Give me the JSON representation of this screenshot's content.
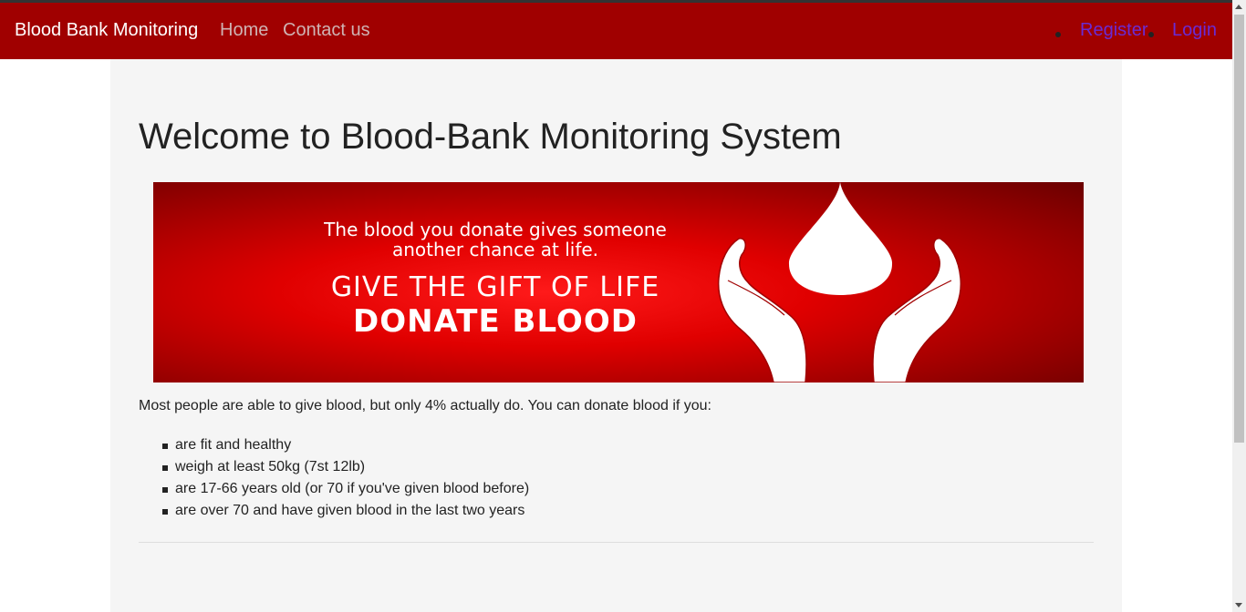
{
  "navbar": {
    "brand": "Blood Bank Monitoring",
    "links": [
      "Home",
      "Contact us"
    ],
    "right_links": [
      "Register",
      "Login"
    ],
    "background": "#a00000"
  },
  "main": {
    "title": "Welcome to Blood-Bank Monitoring System",
    "banner": {
      "line1": "The blood you donate gives someone",
      "line2": "another chance at life.",
      "line3": "GIVE THE GIFT OF LIFE",
      "line4": "DONATE BLOOD",
      "icon": "blood-drop-hands-icon"
    },
    "intro": "Most people are able to give blood, but only 4% actually do. You can donate blood if you:",
    "requirements": [
      "are fit and healthy",
      "weigh at least 50kg (7st 12lb)",
      "are 17-66 years old (or 70 if you've given blood before)",
      "are over 70 and have given blood in the last two years"
    ]
  }
}
